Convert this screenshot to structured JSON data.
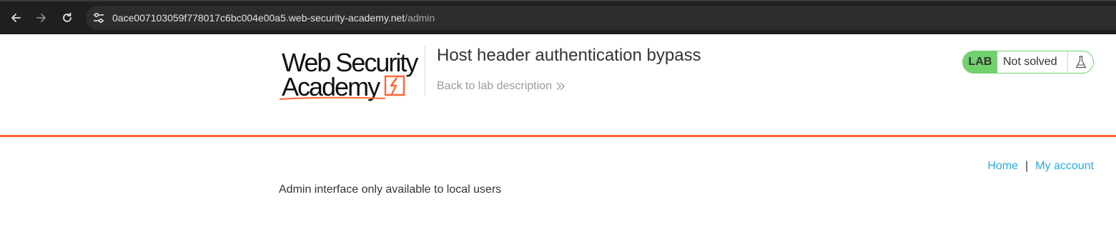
{
  "browser": {
    "back_icon": "arrow-left-icon",
    "forward_icon": "arrow-right-icon",
    "reload_icon": "reload-icon",
    "site_info_icon": "tune-icon",
    "url_host": "0ace007103059f778017c6bc004e00a5.web-security-academy.net",
    "url_path": "/admin"
  },
  "header": {
    "logo_line1": "Web Security",
    "logo_line2": "Academy",
    "title": "Host header authentication bypass",
    "back_link": "Back to lab description",
    "back_icon": "double-chevron-right-icon"
  },
  "lab_status": {
    "badge": "LAB",
    "status": "Not solved",
    "icon": "flask-icon"
  },
  "nav": {
    "home": "Home",
    "separator": "|",
    "my_account": "My account"
  },
  "main": {
    "message": "Admin interface only available to local users"
  },
  "colors": {
    "browser_bg": "#1f1f1f",
    "accent_orange": "#ff6633",
    "lab_green": "#70d16d",
    "link_blue": "#29a8e0",
    "text": "#333332"
  }
}
